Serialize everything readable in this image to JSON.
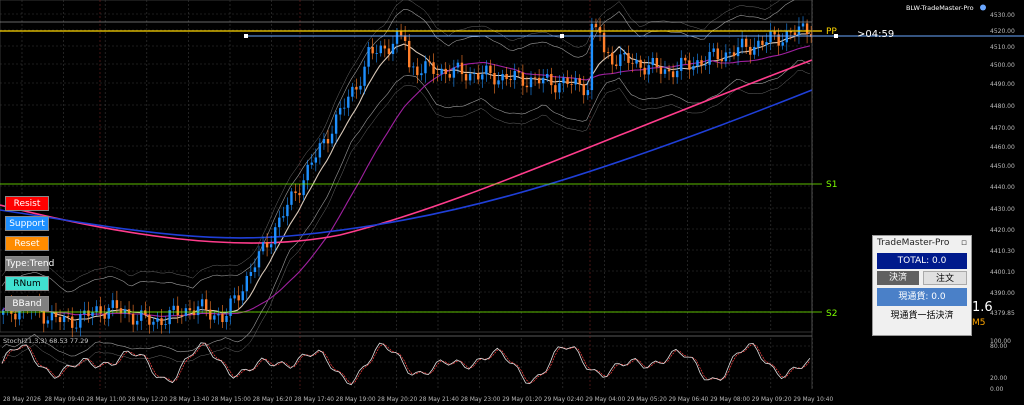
{
  "window": {
    "expert_label": "BLW-TradeMaster-Pro"
  },
  "price_axis": {
    "ticks": [
      "4530.00",
      "4520.00",
      "4510.00",
      "4500.00",
      "4490.00",
      "4480.00",
      "4470.00",
      "4460.00",
      "4450.00",
      "4440.00",
      "4430.00",
      "4420.00",
      "4410.30",
      "4400.10",
      "4390.00",
      "4379.85"
    ]
  },
  "osc_axis": {
    "ticks": [
      "100.00",
      "80.00",
      "20.00",
      "0.00"
    ]
  },
  "time_axis": {
    "ticks": [
      "28 May 2026",
      "28 May 09:40",
      "28 May 11:00",
      "28 May 12:20",
      "28 May 13:40",
      "28 May 15:00",
      "28 May 16:20",
      "28 May 17:40",
      "28 May 19:00",
      "28 May 20:20",
      "28 May 21:40",
      "28 May 23:00",
      "29 May 01:20",
      "29 May 02:40",
      "29 May 04:00",
      "29 May 05:20",
      "29 May 06:40",
      "29 May 08:00",
      "29 May 09:20",
      "29 May 10:40"
    ]
  },
  "levels": {
    "pp": "PP",
    "s1": "S1",
    "s2": "S2",
    "timer": ">04:59"
  },
  "indicator": {
    "stoch_label": "Stoch(21,3,3) 68.53 77.29"
  },
  "side_buttons": [
    {
      "label": "Resist",
      "bg": "#ff0000",
      "fg": "#ffffff"
    },
    {
      "label": "Support",
      "bg": "#1e90ff",
      "fg": "#ffffff"
    },
    {
      "label": "Reset",
      "bg": "#ff8c00",
      "fg": "#ffffff"
    },
    {
      "label": "Type:Trend",
      "bg": "#808080",
      "fg": "#ffffff"
    },
    {
      "label": "RNum",
      "bg": "#40e0d0",
      "fg": "#000000"
    },
    {
      "label": "BBand",
      "bg": "#808080",
      "fg": "#ffffff"
    }
  ],
  "panel": {
    "title": "TradeMaster-Pro",
    "close_glyph": "▫",
    "total": "TOTAL: 0.0",
    "settle_label": "決済",
    "order_label": "注文",
    "current_pair": "現通貨: 0.0",
    "close_all": "現通貨一括決済"
  },
  "overlay": {
    "price_fragment": "1.6",
    "timeframe": "M5"
  },
  "colors": {
    "grid": "#3a3a3a",
    "bull": "#1e90ff",
    "bear": "#ff7f2a",
    "pp_line": "#ffd700",
    "level": "#7cfc00",
    "ma_fast": "#d8c8b8",
    "ma_mid": "#a020a0",
    "ma_pink": "#ff3c8c",
    "ma_blue": "#1f3fd8",
    "band": "#9a9a9a"
  }
}
